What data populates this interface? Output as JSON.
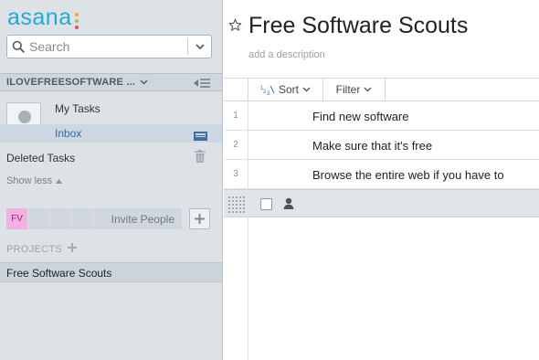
{
  "app": {
    "logo_text": "asana"
  },
  "search": {
    "placeholder": "Search"
  },
  "workspace": {
    "name": "ILOVEFREESOFTWARE ..."
  },
  "sidebar": {
    "my_tasks": "My Tasks",
    "inbox": "Inbox",
    "deleted_tasks": "Deleted Tasks",
    "show_less": "Show less",
    "members": {
      "initials": "FV",
      "invite_label": "Invite People"
    },
    "projects_header": "PROJECTS",
    "projects": [
      {
        "name": "Free Software Scouts"
      }
    ]
  },
  "main": {
    "title": "Free Software Scouts",
    "description_placeholder": "add a description",
    "toolbar": {
      "sort_label": "Sort",
      "filter_label": "Filter"
    },
    "tasks": [
      {
        "num": "1",
        "text": "Find new software"
      },
      {
        "num": "2",
        "text": "Make sure that it's free"
      },
      {
        "num": "3",
        "text": "Browse the entire web if you have to"
      }
    ]
  },
  "colors": {
    "brand": "#22a9d6",
    "sidebar_bg": "#dde2e7",
    "selected_row": "#cbd3db",
    "member_badge": "#f3b0e0"
  },
  "icons": [
    "search-icon",
    "chevron-down-icon",
    "collapse-sidebar-icon",
    "user-avatar-icon",
    "inbox-tray-icon",
    "trash-icon",
    "triangle-up-icon",
    "plus-icon",
    "star-icon",
    "sort-icon",
    "drag-handle-icon",
    "checkbox-icon",
    "assignee-icon"
  ]
}
